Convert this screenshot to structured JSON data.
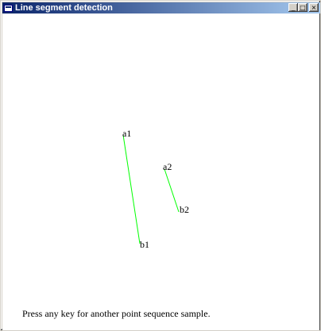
{
  "window": {
    "title": "Line segment detection",
    "buttons": {
      "minimize": "_",
      "maximize": "□",
      "close": "×"
    }
  },
  "canvas": {
    "segment_color": "#00ff00",
    "labels": {
      "a1": "a1",
      "b1": "b1",
      "a2": "a2",
      "b2": "b2"
    }
  },
  "footer": {
    "instruction": "Press any key for another point sequence sample."
  }
}
